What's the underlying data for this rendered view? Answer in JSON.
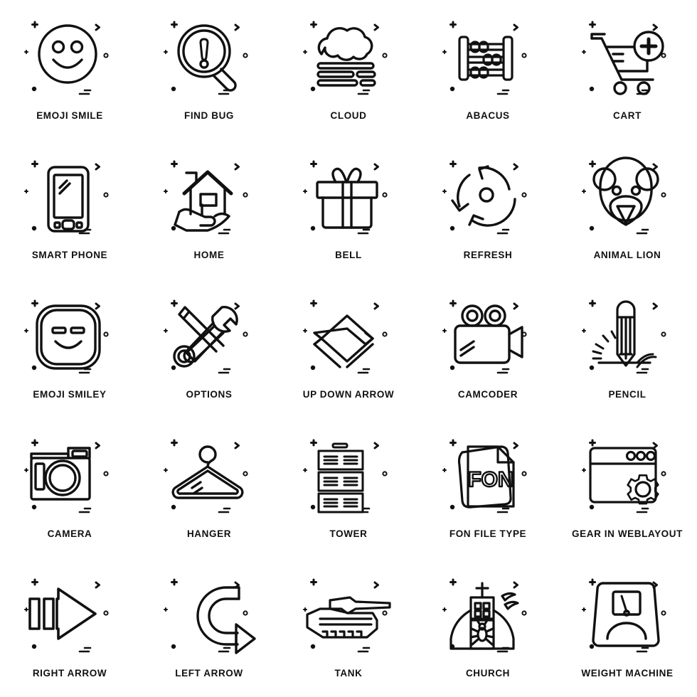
{
  "page": {
    "title": "Line Icon Set",
    "background_color": "#ffffff",
    "stroke_color": "#111111",
    "columns": 5,
    "rows": 5
  },
  "icons": [
    {
      "label": "EMOJI SMILE",
      "icon": "emoji-smile-icon"
    },
    {
      "label": "FIND BUG",
      "icon": "find-bug-icon"
    },
    {
      "label": "CLOUD",
      "icon": "cloud-icon"
    },
    {
      "label": "ABACUS",
      "icon": "abacus-icon"
    },
    {
      "label": "CART",
      "icon": "cart-add-icon"
    },
    {
      "label": "SMART PHONE",
      "icon": "smart-phone-icon"
    },
    {
      "label": "HOME",
      "icon": "home-in-hand-icon"
    },
    {
      "label": "BELL",
      "icon": "gift-box-icon"
    },
    {
      "label": "REFRESH",
      "icon": "refresh-icon"
    },
    {
      "label": "ANIMAL LION",
      "icon": "animal-bear-face-icon"
    },
    {
      "label": "EMOJI SMILEY",
      "icon": "emoji-smiley-square-icon"
    },
    {
      "label": "OPTIONS",
      "icon": "tools-options-icon"
    },
    {
      "label": "UP DOWN ARROW",
      "icon": "up-down-chevron-icon"
    },
    {
      "label": "CAMCODER",
      "icon": "camcorder-icon"
    },
    {
      "label": "PENCIL",
      "icon": "pencil-icon"
    },
    {
      "label": "CAMERA",
      "icon": "camera-icon"
    },
    {
      "label": "HANGER",
      "icon": "hanger-icon"
    },
    {
      "label": "TOWER",
      "icon": "server-tower-icon"
    },
    {
      "label": "FON FILE TYPE",
      "icon": "fon-file-icon"
    },
    {
      "label": "GEAR IN WEBLAYOUT",
      "icon": "gear-in-weblayout-icon"
    },
    {
      "label": "RIGHT ARROW",
      "icon": "right-arrow-icon"
    },
    {
      "label": "LEFT ARROW",
      "icon": "left-curved-arrow-icon"
    },
    {
      "label": "TANK",
      "icon": "tank-icon"
    },
    {
      "label": "CHURCH",
      "icon": "church-icon"
    },
    {
      "label": "WEIGHT MACHINE",
      "icon": "weight-machine-icon"
    }
  ],
  "file_icon_text": "FON"
}
